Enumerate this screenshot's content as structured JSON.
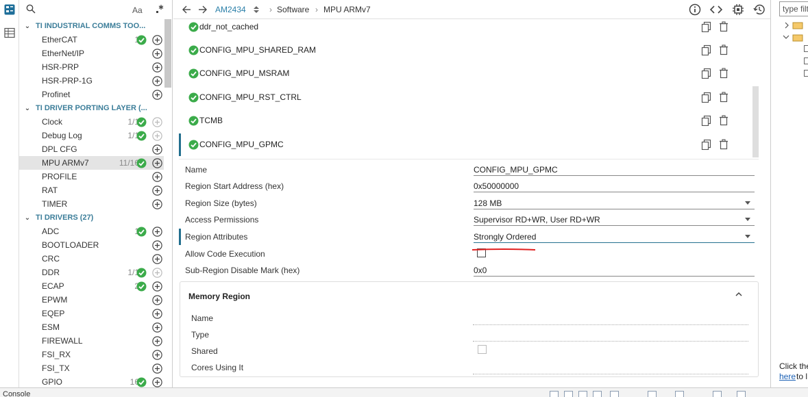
{
  "sidebar": {
    "search_font_toggle": "Aa",
    "groups": [
      {
        "title": "TI INDUSTRIAL COMMS TOO...",
        "items": [
          {
            "label": "EtherCAT",
            "count": "1",
            "check": true
          },
          {
            "label": "EtherNet/IP",
            "count": "",
            "check": false
          },
          {
            "label": "HSR-PRP",
            "count": "",
            "check": false
          },
          {
            "label": "HSR-PRP-1G",
            "count": "",
            "check": false
          },
          {
            "label": "Profinet",
            "count": "",
            "check": false
          }
        ]
      },
      {
        "title": "TI DRIVER PORTING LAYER (...",
        "items": [
          {
            "label": "Clock",
            "count": "1/1",
            "check": true
          },
          {
            "label": "Debug Log",
            "count": "1/1",
            "check": true
          },
          {
            "label": "DPL CFG",
            "count": "",
            "check": false
          },
          {
            "label": "MPU ARMv7",
            "count": "11/16",
            "check": true,
            "selected": true
          },
          {
            "label": "PROFILE",
            "count": "",
            "check": false
          },
          {
            "label": "RAT",
            "count": "",
            "check": false
          },
          {
            "label": "TIMER",
            "count": "",
            "check": false
          }
        ]
      },
      {
        "title": "TI DRIVERS (27)",
        "items": [
          {
            "label": "ADC",
            "count": "1",
            "check": true
          },
          {
            "label": "BOOTLOADER",
            "count": "",
            "check": false
          },
          {
            "label": "CRC",
            "count": "",
            "check": false
          },
          {
            "label": "DDR",
            "count": "1/1",
            "check": true
          },
          {
            "label": "ECAP",
            "count": "2",
            "check": true
          },
          {
            "label": "EPWM",
            "count": "",
            "check": false
          },
          {
            "label": "EQEP",
            "count": "",
            "check": false
          },
          {
            "label": "ESM",
            "count": "",
            "check": false
          },
          {
            "label": "FIREWALL",
            "count": "",
            "check": false
          },
          {
            "label": "FSI_RX",
            "count": "",
            "check": false
          },
          {
            "label": "FSI_TX",
            "count": "",
            "check": false
          },
          {
            "label": "GPIO",
            "count": "16",
            "check": true
          }
        ]
      }
    ]
  },
  "topbar": {
    "device": "AM2434",
    "breadcrumb_1": "Software",
    "breadcrumb_sep": "›",
    "breadcrumb_2": "MPU ARMv7"
  },
  "right_panel": {
    "filter_placeholder": "type filter text",
    "help_text_1": "Click the",
    "help_link": "here",
    "help_text_2": "to l"
  },
  "regions": [
    {
      "name": "ddr_not_cached"
    },
    {
      "name": "CONFIG_MPU_SHARED_RAM"
    },
    {
      "name": "CONFIG_MPU_MSRAM"
    },
    {
      "name": "CONFIG_MPU_RST_CTRL"
    },
    {
      "name": "TCMB"
    },
    {
      "name": "CONFIG_MPU_GPMC",
      "selected": true
    }
  ],
  "properties": {
    "name": {
      "label": "Name",
      "value": "CONFIG_MPU_GPMC"
    },
    "start": {
      "label": "Region Start Address (hex)",
      "value": "0x50000000"
    },
    "size": {
      "label": "Region Size (bytes)",
      "value": "128 MB"
    },
    "access": {
      "label": "Access Permissions",
      "value": "Supervisor RD+WR, User RD+WR"
    },
    "attributes": {
      "label": "Region Attributes",
      "value": "Strongly Ordered"
    },
    "code_exec": {
      "label": "Allow Code Execution",
      "checked": false
    },
    "subregion": {
      "label": "Sub-Region Disable Mark (hex)",
      "value": "0x0"
    }
  },
  "memory_region": {
    "title": "Memory Region",
    "fields": {
      "name": "Name",
      "type": "Type",
      "shared": "Shared",
      "cores": "Cores Using It"
    }
  },
  "bottom": {
    "console_label": "Console"
  },
  "colors": {
    "accent": "#236f8e",
    "check_green": "#3bab4a",
    "category_text": "#3b7d99",
    "annotation_red": "#e02020"
  }
}
